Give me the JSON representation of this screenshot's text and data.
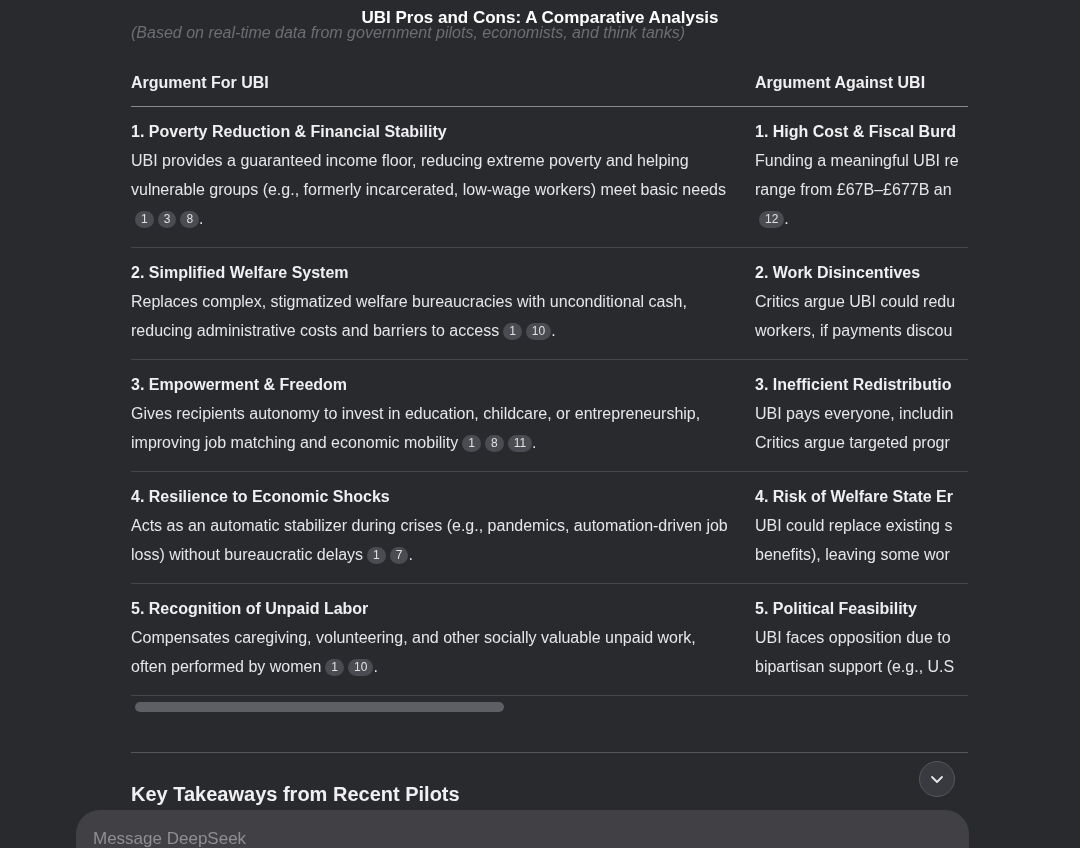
{
  "title": "UBI Pros and Cons: A Comparative Analysis",
  "subtitle": "(Based on real-time data from government pilots, economists, and think tanks)",
  "table": {
    "columns": [
      "Argument For UBI",
      "Argument Against UBI"
    ],
    "rows": [
      {
        "for": {
          "title": "1. Poverty Reduction & Financial Stability",
          "text": "UBI provides a guaranteed income floor, reducing extreme poverty and helping vulnerable groups (e.g., formerly incarcerated, low-wage workers) meet basic needs",
          "cites": [
            "1",
            "3",
            "8"
          ],
          "end": "."
        },
        "against": {
          "title": "1. High Cost & Fiscal Burd",
          "lines": [
            "Funding a meaningful UBI re",
            "range from £67B–£677B an"
          ],
          "cites": [
            "12"
          ],
          "end": "."
        }
      },
      {
        "for": {
          "title": "2. Simplified Welfare System",
          "text": "Replaces complex, stigmatized welfare bureaucracies with unconditional cash, reducing administrative costs and barriers to access",
          "cites": [
            "1",
            "10"
          ],
          "end": "."
        },
        "against": {
          "title": "2. Work Disincentives",
          "lines": [
            "Critics argue UBI could redu",
            "workers, if payments discou"
          ]
        }
      },
      {
        "for": {
          "title": "3. Empowerment & Freedom",
          "text": "Gives recipients autonomy to invest in education, childcare, or entrepreneurship, improving job matching and economic mobility",
          "cites": [
            "1",
            "8",
            "11"
          ],
          "end": "."
        },
        "against": {
          "title": "3. Inefficient Redistributio",
          "lines": [
            "UBI pays everyone, includin",
            "Critics argue targeted progr"
          ]
        }
      },
      {
        "for": {
          "title": "4. Resilience to Economic Shocks",
          "text": "Acts as an automatic stabilizer during crises (e.g., pandemics, automation-driven job loss) without bureaucratic delays",
          "cites": [
            "1",
            "7"
          ],
          "end": "."
        },
        "against": {
          "title": "4. Risk of Welfare State Er",
          "lines": [
            "UBI could replace existing s",
            "benefits), leaving some wor"
          ]
        }
      },
      {
        "for": {
          "title": "5. Recognition of Unpaid Labor",
          "text": "Compensates caregiving, volunteering, and other socially valuable unpaid work, often performed by women",
          "cites": [
            "1",
            "10"
          ],
          "end": "."
        },
        "against": {
          "title": "5. Political Feasibility",
          "lines": [
            "UBI faces opposition due to",
            "bipartisan support (e.g., U.S"
          ]
        }
      }
    ]
  },
  "next_heading": "Key Takeaways from Recent Pilots",
  "composer": {
    "placeholder": "Message DeepSeek"
  }
}
